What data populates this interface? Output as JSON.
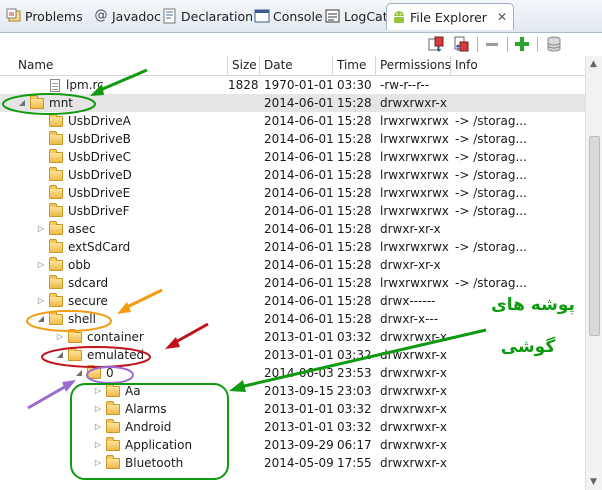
{
  "tabs": [
    {
      "label": "Problems",
      "icon": "problems-icon"
    },
    {
      "label": "Javadoc",
      "icon": "at-icon"
    },
    {
      "label": "Declaration",
      "icon": "declaration-icon"
    },
    {
      "label": "Console",
      "icon": "console-icon"
    },
    {
      "label": "LogCat",
      "icon": "logcat-icon"
    },
    {
      "label": "File Explorer",
      "icon": "android-icon",
      "close": "✕"
    }
  ],
  "toolbar": {
    "buttons": [
      "pull-file-icon",
      "push-file-icon",
      "delete-icon",
      "new-folder-icon",
      "view-menu-icon"
    ]
  },
  "columns": {
    "name": "Name",
    "size": "Size",
    "date": "Date",
    "time": "Time",
    "permissions": "Permissions",
    "info": "Info"
  },
  "rows": [
    {
      "name": "lpm.rc",
      "size": "1828",
      "date": "1970-01-01",
      "time": "03:30",
      "perm": "-rw-r--r--",
      "info": ""
    },
    {
      "name": "mnt",
      "size": "",
      "date": "2014-06-01",
      "time": "15:28",
      "perm": "drwxrwxr-x",
      "info": ""
    },
    {
      "name": "UsbDriveA",
      "size": "",
      "date": "2014-06-01",
      "time": "15:28",
      "perm": "lrwxrwxrwx",
      "info": "-> /storag..."
    },
    {
      "name": "UsbDriveB",
      "size": "",
      "date": "2014-06-01",
      "time": "15:28",
      "perm": "lrwxrwxrwx",
      "info": "-> /storag..."
    },
    {
      "name": "UsbDriveC",
      "size": "",
      "date": "2014-06-01",
      "time": "15:28",
      "perm": "lrwxrwxrwx",
      "info": "-> /storag..."
    },
    {
      "name": "UsbDriveD",
      "size": "",
      "date": "2014-06-01",
      "time": "15:28",
      "perm": "lrwxrwxrwx",
      "info": "-> /storag..."
    },
    {
      "name": "UsbDriveE",
      "size": "",
      "date": "2014-06-01",
      "time": "15:28",
      "perm": "lrwxrwxrwx",
      "info": "-> /storag..."
    },
    {
      "name": "UsbDriveF",
      "size": "",
      "date": "2014-06-01",
      "time": "15:28",
      "perm": "lrwxrwxrwx",
      "info": "-> /storag..."
    },
    {
      "name": "asec",
      "size": "",
      "date": "2014-06-01",
      "time": "15:28",
      "perm": "drwxr-xr-x",
      "info": ""
    },
    {
      "name": "extSdCard",
      "size": "",
      "date": "2014-06-01",
      "time": "15:28",
      "perm": "lrwxrwxrwx",
      "info": "-> /storag..."
    },
    {
      "name": "obb",
      "size": "",
      "date": "2014-06-01",
      "time": "15:28",
      "perm": "drwxr-xr-x",
      "info": ""
    },
    {
      "name": "sdcard",
      "size": "",
      "date": "2014-06-01",
      "time": "15:28",
      "perm": "lrwxrwxrwx",
      "info": "-> /storag..."
    },
    {
      "name": "secure",
      "size": "",
      "date": "2014-06-01",
      "time": "15:28",
      "perm": "drwx------",
      "info": ""
    },
    {
      "name": "shell",
      "size": "",
      "date": "2014-06-01",
      "time": "15:28",
      "perm": "drwxr-x---",
      "info": ""
    },
    {
      "name": "container",
      "size": "",
      "date": "2013-01-01",
      "time": "03:32",
      "perm": "drwxrwxr-x",
      "info": ""
    },
    {
      "name": "emulated",
      "size": "",
      "date": "2013-01-01",
      "time": "03:32",
      "perm": "drwxrwxr-x",
      "info": ""
    },
    {
      "name": "0",
      "size": "",
      "date": "2014-06-03",
      "time": "23:53",
      "perm": "drwxrwxr-x",
      "info": ""
    },
    {
      "name": "Aa",
      "size": "",
      "date": "2013-09-15",
      "time": "23:03",
      "perm": "drwxrwxr-x",
      "info": ""
    },
    {
      "name": "Alarms",
      "size": "",
      "date": "2013-01-01",
      "time": "03:32",
      "perm": "drwxrwxr-x",
      "info": ""
    },
    {
      "name": "Android",
      "size": "",
      "date": "2013-01-01",
      "time": "03:32",
      "perm": "drwxrwxr-x",
      "info": ""
    },
    {
      "name": "Application",
      "size": "",
      "date": "2013-09-29",
      "time": "06:17",
      "perm": "drwxrwxr-x",
      "info": ""
    },
    {
      "name": "Bluetooth",
      "size": "",
      "date": "2014-05-09",
      "time": "17:55",
      "perm": "drwxrwxr-x",
      "info": ""
    }
  ],
  "annotation": {
    "line1": "پوشه های",
    "line2": "گوشی",
    "colors": {
      "green": "#109a10",
      "orange": "#f39c12",
      "red": "#c0121b",
      "purple": "#9a6bd1"
    }
  },
  "colors": {
    "selected_row": "#e5e5e5",
    "header_border": "#d6d6d6"
  }
}
